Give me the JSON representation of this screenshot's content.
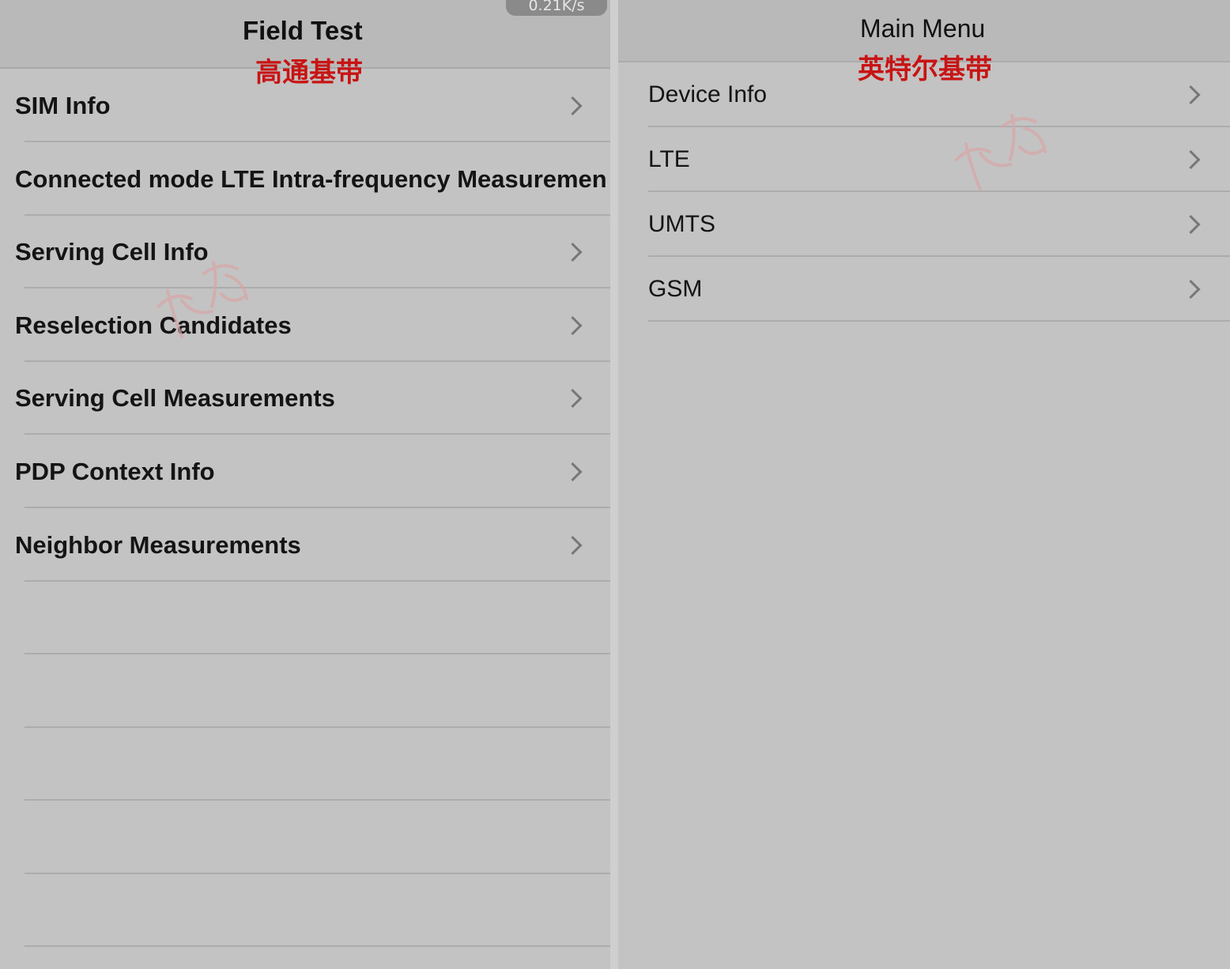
{
  "left_panel": {
    "title": "Field Test",
    "caption": "高通基带",
    "speed_badge": "0.21K/s",
    "items": [
      {
        "label": "SIM Info",
        "icon": "chevron-right-icon"
      },
      {
        "label": "Connected mode LTE Intra-frequency Measuremen",
        "icon": "chevron-right-icon"
      },
      {
        "label": "Serving Cell Info",
        "icon": "chevron-right-icon"
      },
      {
        "label": "Reselection Candidates",
        "icon": "chevron-right-icon"
      },
      {
        "label": "Serving Cell Measurements",
        "icon": "chevron-right-icon"
      },
      {
        "label": "PDP Context Info",
        "icon": "chevron-right-icon"
      },
      {
        "label": "Neighbor Measurements",
        "icon": "chevron-right-icon"
      }
    ]
  },
  "right_panel": {
    "title": "Main Menu",
    "caption": "英特尔基带",
    "items": [
      {
        "label": "Device Info",
        "icon": "chevron-right-icon"
      },
      {
        "label": "LTE",
        "icon": "chevron-right-icon"
      },
      {
        "label": "UMTS",
        "icon": "chevron-right-icon"
      },
      {
        "label": "GSM",
        "icon": "chevron-right-icon"
      }
    ]
  },
  "colors": {
    "background": "#c3c3c3",
    "navbar": "#b9b9b9",
    "caption_red": "#c81414",
    "watermark": "#d9a6a6"
  }
}
